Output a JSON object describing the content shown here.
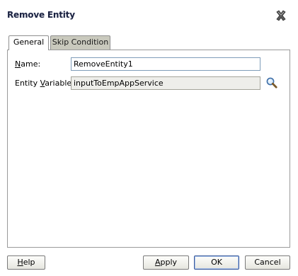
{
  "dialog": {
    "title": "Remove Entity",
    "close_icon": "close-icon"
  },
  "tabs": [
    {
      "label": "General",
      "selected": true
    },
    {
      "label": "Skip Condition",
      "selected": false
    }
  ],
  "form": {
    "name": {
      "label_mnemonic": "N",
      "label_rest": "ame:",
      "value": "RemoveEntity1"
    },
    "entity_variable": {
      "label_prefix": "Entity ",
      "label_mnemonic": "V",
      "label_rest": "ariable:",
      "value": "inputToEmpAppService",
      "browse_icon": "search-icon"
    }
  },
  "buttons": {
    "help": {
      "mnemonic": "H",
      "rest": "elp"
    },
    "apply": {
      "mnemonic": "A",
      "rest": "pply"
    },
    "ok": "OK",
    "cancel": "Cancel"
  },
  "colors": {
    "title": "#1b2240",
    "inactive_tab": "#c9c9bd",
    "readonly_field": "#eeeeea",
    "input_border": "#7f9db9"
  }
}
